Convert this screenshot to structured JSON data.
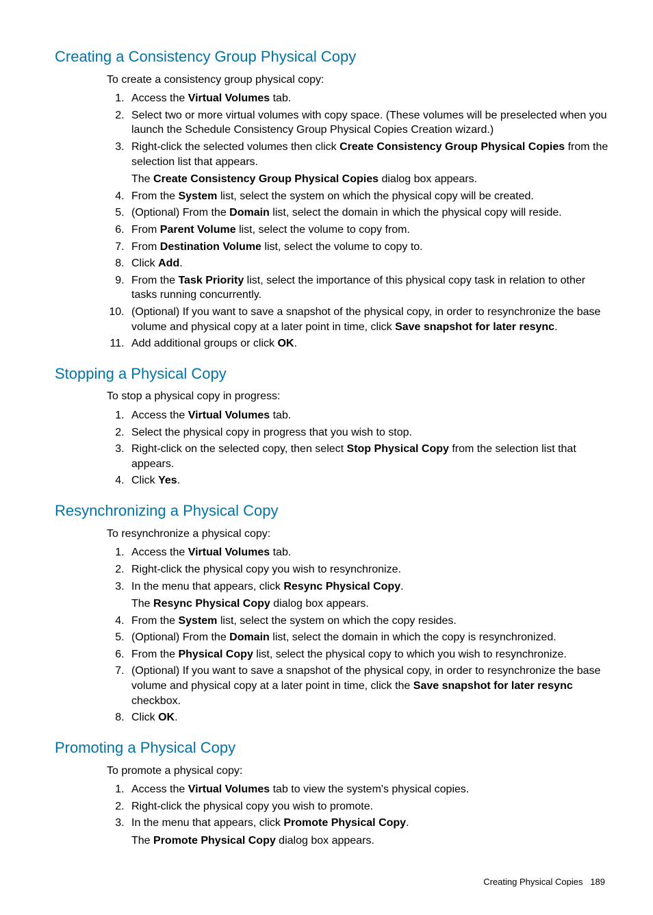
{
  "sections": [
    {
      "heading": "Creating a Consistency Group Physical Copy",
      "intro": "To create a consistency group physical copy:",
      "steps": [
        {
          "parts": [
            {
              "t": "Access the "
            },
            {
              "t": "Virtual Volumes",
              "b": true
            },
            {
              "t": " tab."
            }
          ]
        },
        {
          "parts": [
            {
              "t": "Select two or more virtual volumes with copy space. (These volumes will be preselected when you launch the Schedule Consistency Group Physical Copies Creation wizard.)"
            }
          ]
        },
        {
          "parts": [
            {
              "t": "Right-click the selected volumes then click "
            },
            {
              "t": "Create Consistency Group Physical Copies",
              "b": true
            },
            {
              "t": " from the selection list that appears."
            }
          ],
          "sub": [
            {
              "t": "The "
            },
            {
              "t": "Create Consistency Group Physical Copies",
              "b": true
            },
            {
              "t": " dialog box appears."
            }
          ]
        },
        {
          "parts": [
            {
              "t": "From the "
            },
            {
              "t": "System",
              "b": true
            },
            {
              "t": " list, select the system on which the physical copy will be created."
            }
          ]
        },
        {
          "parts": [
            {
              "t": "(Optional) From the "
            },
            {
              "t": "Domain",
              "b": true
            },
            {
              "t": " list, select the domain in which the physical copy will reside."
            }
          ]
        },
        {
          "parts": [
            {
              "t": "From "
            },
            {
              "t": "Parent Volume",
              "b": true
            },
            {
              "t": " list, select the volume to copy from."
            }
          ]
        },
        {
          "parts": [
            {
              "t": "From "
            },
            {
              "t": "Destination Volume",
              "b": true
            },
            {
              "t": " list, select the volume to copy to."
            }
          ]
        },
        {
          "parts": [
            {
              "t": "Click "
            },
            {
              "t": "Add",
              "b": true
            },
            {
              "t": "."
            }
          ]
        },
        {
          "parts": [
            {
              "t": "From the "
            },
            {
              "t": "Task Priority",
              "b": true
            },
            {
              "t": " list, select the importance of this physical copy task in relation to other tasks running concurrently."
            }
          ]
        },
        {
          "parts": [
            {
              "t": "(Optional) If you want to save a snapshot of the physical copy, in order to resynchronize the base volume and physical copy at a later point in time, click "
            },
            {
              "t": "Save snapshot for later resync",
              "b": true
            },
            {
              "t": "."
            }
          ]
        },
        {
          "parts": [
            {
              "t": "Add additional groups or click "
            },
            {
              "t": "OK",
              "b": true
            },
            {
              "t": "."
            }
          ]
        }
      ]
    },
    {
      "heading": "Stopping a Physical Copy",
      "intro": "To stop a physical copy in progress:",
      "steps": [
        {
          "parts": [
            {
              "t": "Access the "
            },
            {
              "t": "Virtual Volumes",
              "b": true
            },
            {
              "t": " tab."
            }
          ]
        },
        {
          "parts": [
            {
              "t": "Select the physical copy in progress that you wish to stop."
            }
          ]
        },
        {
          "parts": [
            {
              "t": "Right-click on the selected copy, then select "
            },
            {
              "t": "Stop Physical Copy",
              "b": true
            },
            {
              "t": " from the selection list that appears."
            }
          ]
        },
        {
          "parts": [
            {
              "t": "Click "
            },
            {
              "t": "Yes",
              "b": true
            },
            {
              "t": "."
            }
          ]
        }
      ]
    },
    {
      "heading": "Resynchronizing a Physical Copy",
      "intro": "To resynchronize a physical copy:",
      "steps": [
        {
          "parts": [
            {
              "t": "Access the "
            },
            {
              "t": "Virtual Volumes",
              "b": true
            },
            {
              "t": " tab."
            }
          ]
        },
        {
          "parts": [
            {
              "t": "Right-click the physical copy you wish to resynchronize."
            }
          ]
        },
        {
          "parts": [
            {
              "t": "In the menu that appears, click "
            },
            {
              "t": "Resync Physical Copy",
              "b": true
            },
            {
              "t": "."
            }
          ],
          "sub": [
            {
              "t": "The "
            },
            {
              "t": "Resync Physical Copy",
              "b": true
            },
            {
              "t": " dialog box appears."
            }
          ]
        },
        {
          "parts": [
            {
              "t": "From the "
            },
            {
              "t": "System",
              "b": true
            },
            {
              "t": " list, select the system on which the copy resides."
            }
          ]
        },
        {
          "parts": [
            {
              "t": "(Optional) From the "
            },
            {
              "t": "Domain",
              "b": true
            },
            {
              "t": " list, select the domain in which the copy is resynchronized."
            }
          ]
        },
        {
          "parts": [
            {
              "t": "From the "
            },
            {
              "t": "Physical Copy",
              "b": true
            },
            {
              "t": " list, select the physical copy to which you wish to resynchronize."
            }
          ]
        },
        {
          "parts": [
            {
              "t": "(Optional) If you want to save a snapshot of the physical copy, in order to resynchronize the base volume and physical copy at a later point in time, click the "
            },
            {
              "t": "Save snapshot for later resync",
              "b": true
            },
            {
              "t": " checkbox."
            }
          ]
        },
        {
          "parts": [
            {
              "t": "Click "
            },
            {
              "t": "OK",
              "b": true
            },
            {
              "t": "."
            }
          ]
        }
      ]
    },
    {
      "heading": "Promoting a Physical Copy",
      "intro": "To promote a physical copy:",
      "steps": [
        {
          "parts": [
            {
              "t": "Access the "
            },
            {
              "t": "Virtual Volumes",
              "b": true
            },
            {
              "t": " tab to view the system's physical copies."
            }
          ]
        },
        {
          "parts": [
            {
              "t": "Right-click the physical copy you wish to promote."
            }
          ]
        },
        {
          "parts": [
            {
              "t": "In the menu that appears, click "
            },
            {
              "t": "Promote Physical Copy",
              "b": true
            },
            {
              "t": "."
            }
          ],
          "sub": [
            {
              "t": "The "
            },
            {
              "t": "Promote Physical Copy",
              "b": true
            },
            {
              "t": " dialog box appears."
            }
          ]
        }
      ]
    }
  ],
  "footer": {
    "title": "Creating Physical Copies",
    "page": "189"
  }
}
